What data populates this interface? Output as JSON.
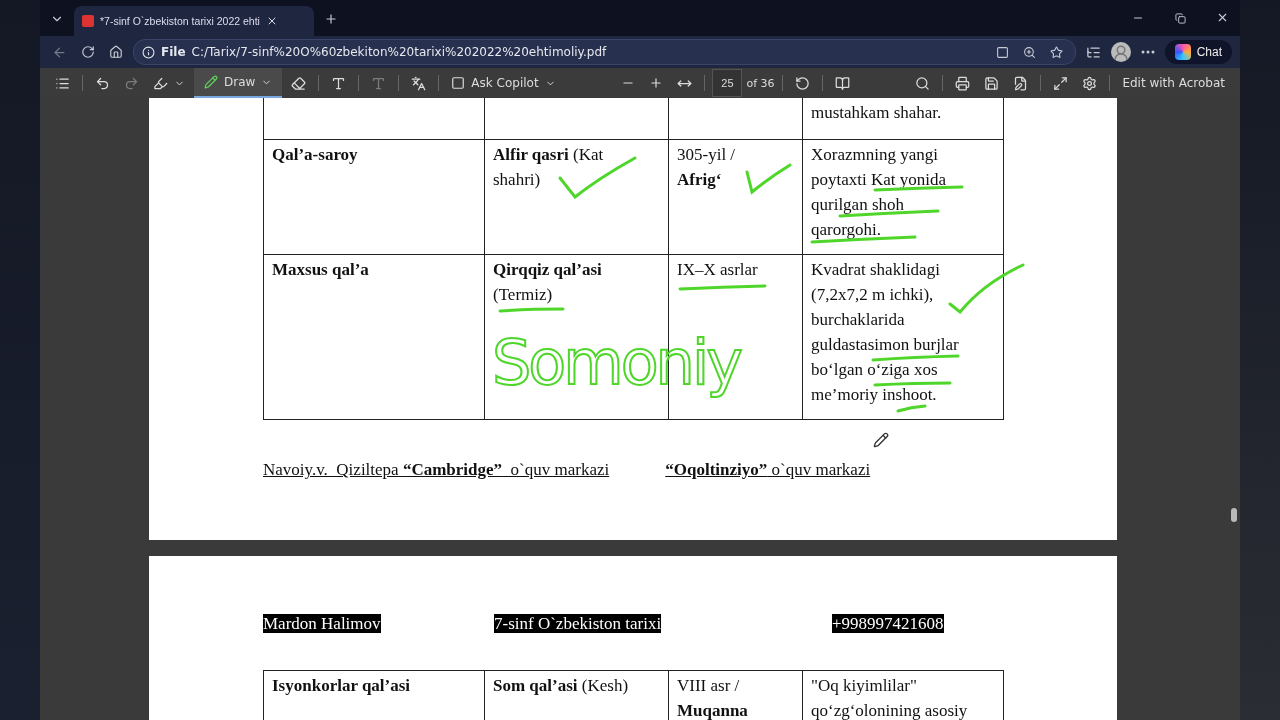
{
  "window": {
    "tab_title": "*7-sinf O`zbekiston tarixi 2022 ehti",
    "address_scheme": "File",
    "url": "C:/Tarix/7-sinf%20O%60zbekiton%20tarixi%202022%20ehtimoliy.pdf",
    "chat_label": "Chat"
  },
  "pdf_toolbar": {
    "draw_label": "Draw",
    "copilot_label": "Ask Copilot",
    "page": "25",
    "page_count": "of 36",
    "edit_label": "Edit with Acrobat"
  },
  "document": {
    "handwritten_note": "Somoniy",
    "pages": [
      {
        "table_rows": [
          {
            "cells": [
              {},
              {},
              {},
              {
                "lines": [
                  "mustahkam shahar."
                ]
              }
            ]
          },
          {
            "cells": [
              {
                "lines": [
                  "**Qal’a-saroy**"
                ]
              },
              {
                "lines": [
                  "**Alfir qasri** (Kat",
                  "shahri)"
                ]
              },
              {
                "lines": [
                  "305-yil /",
                  "**Afrig‘**"
                ]
              },
              {
                "lines": [
                  "Xorazmning yangi",
                  "poytaxti Kat yonida",
                  "qurilgan shoh",
                  "qarorgohi."
                ]
              }
            ]
          },
          {
            "cells": [
              {
                "lines": [
                  "**Maxsus qal’a**"
                ]
              },
              {
                "lines": [
                  "**Qirqqiz qal’asi**",
                  "(Termiz)"
                ]
              },
              {
                "lines": [
                  "IX–X asrlar"
                ]
              },
              {
                "lines": [
                  "Kvadrat shaklidagi",
                  "(7,2x7,2 m ichki),",
                  "burchaklarida",
                  "guldastasimon burjlar",
                  "bo‘lgan o‘ziga xos",
                  "me’moriy inshoot."
                ]
              }
            ]
          }
        ],
        "footer": [
          "Navoiy.v.  Qiziltepa **“Cambridge”**  o`quv markazi",
          "**“Oqoltinziyo”** o`quv markazi"
        ]
      },
      {
        "header": [
          "Mardon Halimov",
          "7-sinf O`zbekiston tarixi",
          "+998997421608"
        ],
        "table_rows": [
          {
            "cells": [
              {
                "lines": [
                  "**Isyonkorlar qal’asi**"
                ]
              },
              {
                "lines": [
                  "**Som qal’asi** (Kesh)"
                ]
              },
              {
                "lines": [
                  "VIII asr /",
                  "**Muqanna**"
                ]
              },
              {
                "lines": [
                  "\"Oq kiyimlilar\"",
                  "qo‘zg‘olonining asosiy"
                ]
              }
            ]
          }
        ]
      }
    ]
  }
}
